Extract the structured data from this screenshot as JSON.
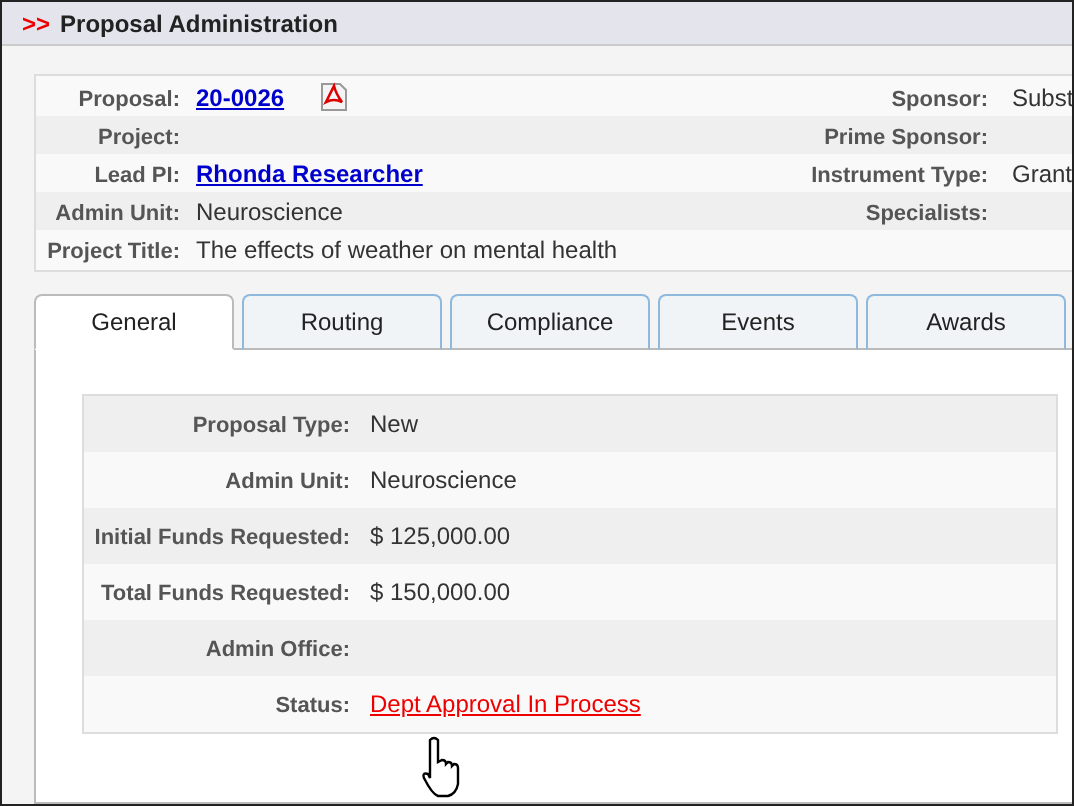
{
  "header": {
    "marker": ">>",
    "title": "Proposal Administration"
  },
  "summary": [
    {
      "label": "Proposal:",
      "value": "20-0026",
      "kind": "link",
      "pdf": true,
      "right_label": "Sponsor:",
      "right_value": "Subst"
    },
    {
      "label": "Project:",
      "right_label": "Prime Sponsor:"
    },
    {
      "label": "Lead PI:",
      "value": "Rhonda Researcher",
      "kind": "link",
      "right_label": "Instrument Type:",
      "right_value": "Grant"
    },
    {
      "label": "Admin Unit:",
      "value": "Neuroscience",
      "kind": "text",
      "right_label": "Specialists:"
    },
    {
      "label": "Project Title:",
      "value": "The effects of weather on mental health",
      "kind": "text"
    }
  ],
  "tabs": [
    {
      "label": "General",
      "selected": true
    },
    {
      "label": "Routing",
      "selected": false
    },
    {
      "label": "Compliance",
      "selected": false
    },
    {
      "label": "Events",
      "selected": false
    },
    {
      "label": "Awards",
      "selected": false
    }
  ],
  "details": [
    {
      "label": "Proposal Type:",
      "value": "New",
      "kind": "text"
    },
    {
      "label": "Admin Unit:",
      "value": "Neuroscience",
      "kind": "text"
    },
    {
      "label": "Initial Funds Requested:",
      "value": "$ 125,000.00",
      "kind": "text"
    },
    {
      "label": "Total Funds Requested:",
      "value": "$ 150,000.00",
      "kind": "text"
    },
    {
      "label": "Admin Office:"
    },
    {
      "label": "Status:",
      "value": "Dept Approval In Process",
      "kind": "alert_link"
    }
  ]
}
